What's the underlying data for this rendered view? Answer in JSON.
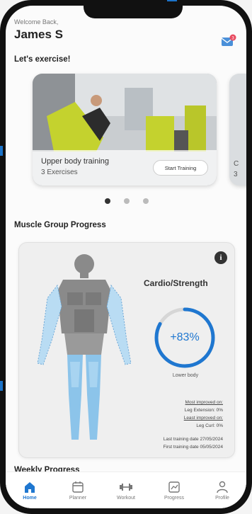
{
  "header": {
    "welcome": "Welcome Back,",
    "name": "James S",
    "mail_badge": "3"
  },
  "exercise": {
    "section_title": "Let's exercise!",
    "cards": [
      {
        "title": "Upper body training",
        "subtitle": "3 Exercises",
        "button": "Start Training"
      },
      {
        "title": "C",
        "subtitle": "3"
      }
    ],
    "carousel_pages": 3,
    "carousel_active": 0
  },
  "muscle": {
    "section_title": "Muscle Group Progress",
    "info_icon": "i",
    "cardio_title": "Cardio/Strength",
    "progress_value": 83,
    "progress_label": "+83%",
    "focus_label": "Lower body",
    "most_improved_title": "Most improved on:",
    "most_improved_value": "Leg Extension: 0%",
    "least_improved_title": "Least improved on:",
    "least_improved_value": "Leg Curl: 0%",
    "last_training": "Last training date 27/05/2024",
    "first_training": "First training date 05/05/2024"
  },
  "weekly": {
    "section_title": "Weekly Progress"
  },
  "nav": {
    "items": [
      {
        "label": "Home",
        "icon": "home-icon",
        "active": true
      },
      {
        "label": "Planner",
        "icon": "calendar-icon",
        "active": false
      },
      {
        "label": "Workout",
        "icon": "dumbbell-icon",
        "active": false
      },
      {
        "label": "Progress",
        "icon": "chart-icon",
        "active": false
      },
      {
        "label": "Profile",
        "icon": "person-icon",
        "active": false
      }
    ]
  },
  "colors": {
    "accent": "#1f77d0",
    "muscle_highlight": "#8cc4ea",
    "muscle_base": "#8a8a8a"
  }
}
